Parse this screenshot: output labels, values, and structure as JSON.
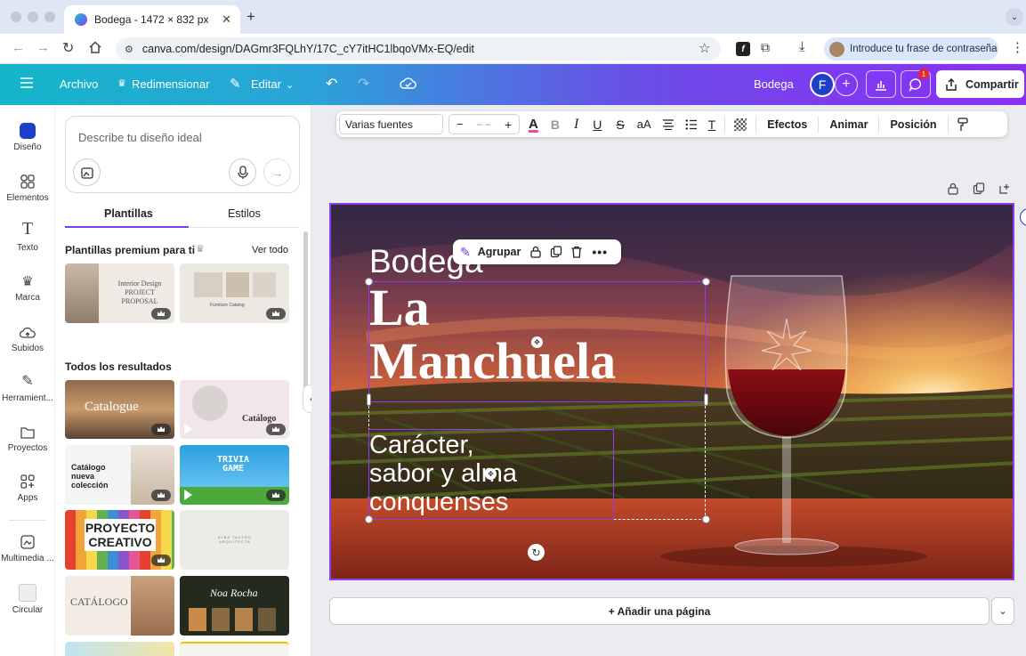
{
  "browser": {
    "tab_title": "Bodega - 1472 × 832 px",
    "url": "canva.com/design/DAGmr3FQLhY/17C_cY7itHC1lbqoVMx-EQ/edit",
    "passphrase_label": "Introduce tu frase de contraseña"
  },
  "topbar": {
    "archivo": "Archivo",
    "redimensionar": "Redimensionar",
    "editar": "Editar",
    "design_name": "Bodega",
    "avatar_letter": "F",
    "notif_count": "1",
    "compartir": "Compartir"
  },
  "rail": {
    "items": [
      "Diseño",
      "Elementos",
      "Texto",
      "Marca",
      "Subidos",
      "Herramient...",
      "Proyectos",
      "Apps",
      "Multimedia ...",
      "Circular"
    ]
  },
  "panel": {
    "prompt_placeholder": "Describe tu diseño ideal",
    "tab_plantillas": "Plantillas",
    "tab_estilos": "Estilos",
    "premium_heading": "Plantillas premium para ti",
    "ver_todo": "Ver todo",
    "results_heading": "Todos los resultados",
    "premium_templates": [
      {
        "title": "Interior Design PROJECT PROPOSAL"
      },
      {
        "title": "Furniture Catalog"
      }
    ],
    "results": [
      {
        "title": "Catalogue"
      },
      {
        "title": "Catálogo"
      },
      {
        "title": "Catálogo nueva colección"
      },
      {
        "title": "TRIVIA GAME"
      },
      {
        "title": "PROYECTO CREATIVO"
      },
      {
        "title": "ALBA TAUTRO ARQUITECTA"
      },
      {
        "title": "CATÁLOGO"
      },
      {
        "title": "Noa Rocha"
      }
    ]
  },
  "textbar": {
    "font": "Varias fuentes",
    "minus": "−",
    "size": "– –",
    "plus": "+",
    "case": "aA",
    "efectos": "Efectos",
    "animar": "Animar",
    "posicion": "Posición"
  },
  "group_toolbar": {
    "agrupar": "Agrupar"
  },
  "canvas": {
    "line1": "Bodega",
    "title_l1": "La",
    "title_l2": "Manchuela",
    "sub_l1": "Carácter,",
    "sub_l2": "sabor y alma",
    "sub_l3": "conquenses"
  },
  "add_page": "+ Añadir una página",
  "colors": {
    "accent": "#8b3ff0",
    "topbar_start": "#15b5c9",
    "topbar_end": "#8b2ff2"
  }
}
